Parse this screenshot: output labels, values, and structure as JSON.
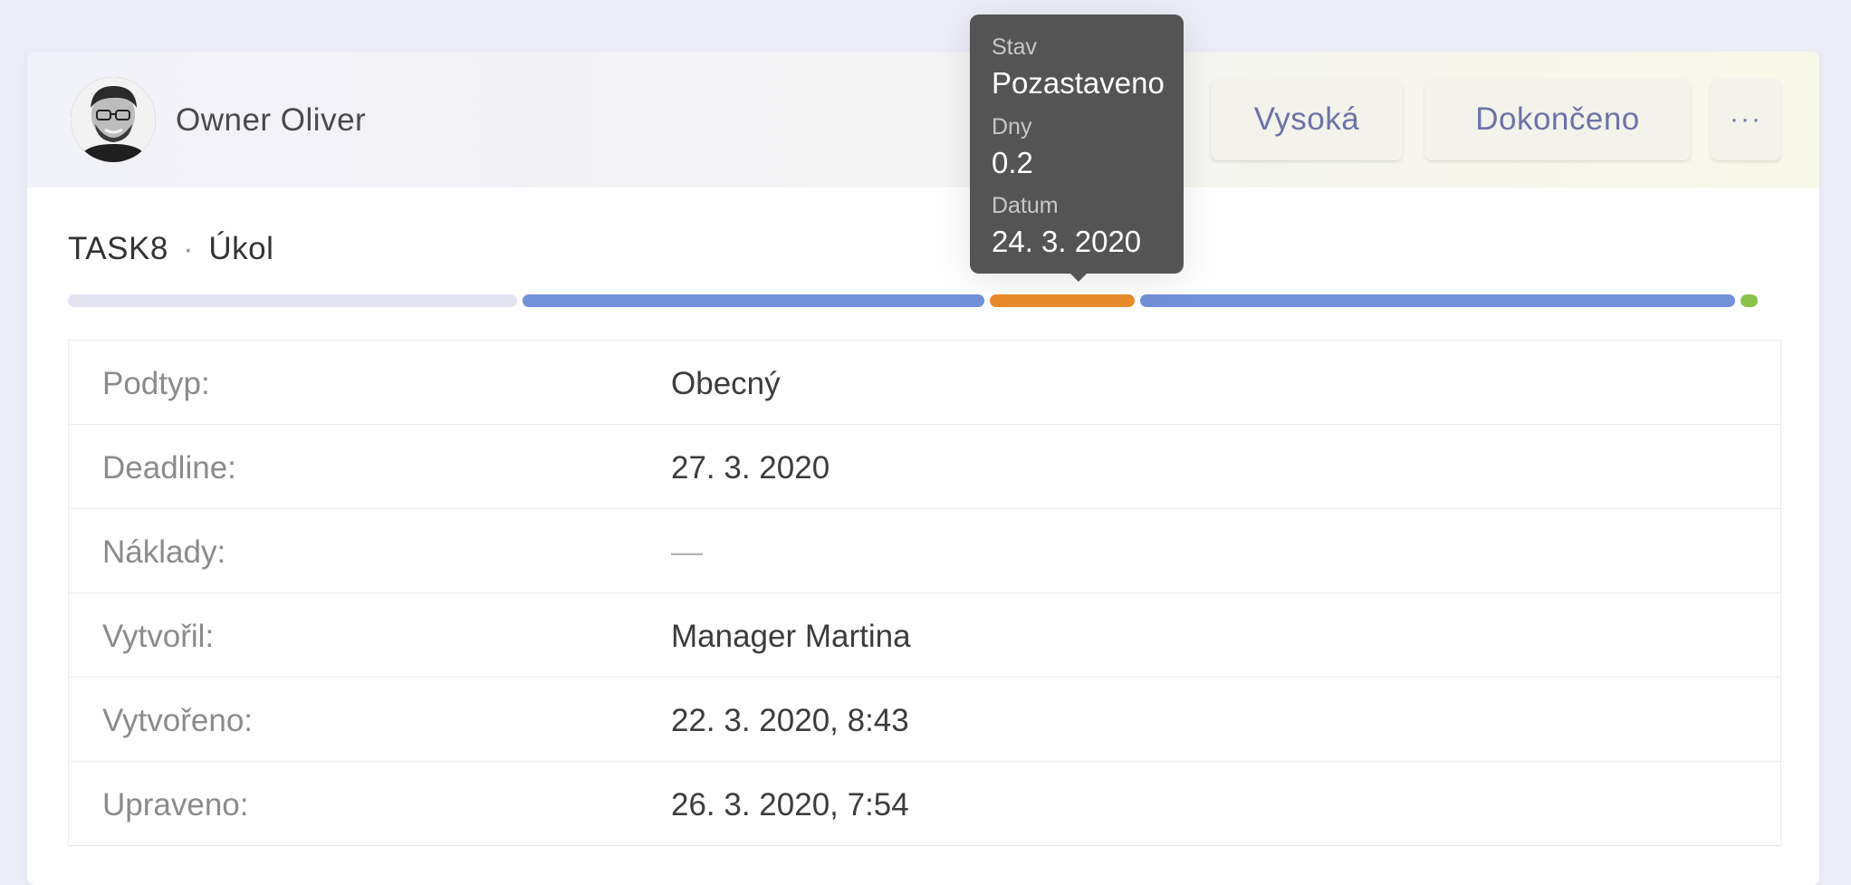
{
  "header": {
    "owner_name": "Owner Oliver",
    "priority_label": "Vysoká",
    "status_label": "Dokončeno",
    "more_label": "···"
  },
  "task": {
    "id": "TASK8",
    "separator": "·",
    "type": "Úkol"
  },
  "timeline": {
    "segments": [
      {
        "state": "pending",
        "color": "#e4e3f1",
        "fraction": 0.2597
      },
      {
        "state": "active",
        "color": "#7391d8",
        "fraction": 0.267
      },
      {
        "state": "paused",
        "color": "#e98b2a",
        "fraction": 0.0838
      },
      {
        "state": "active",
        "color": "#7391d8",
        "fraction": 0.3443
      },
      {
        "state": "done",
        "color": "#8bc34a",
        "fraction": 0.0101
      }
    ]
  },
  "tooltip": {
    "state_label": "Stav",
    "state_value": "Pozastaveno",
    "days_label": "Dny",
    "days_value": "0.2",
    "date_label": "Datum",
    "date_value": "24. 3. 2020"
  },
  "details": [
    {
      "label": "Podtyp:",
      "value": "Obecný",
      "empty": false
    },
    {
      "label": "Deadline:",
      "value": "27. 3. 2020",
      "empty": false
    },
    {
      "label": "Náklady:",
      "value": "—",
      "empty": true
    },
    {
      "label": "Vytvořil:",
      "value": "Manager Martina",
      "empty": false
    },
    {
      "label": "Vytvořeno:",
      "value": "22. 3. 2020, 8:43",
      "empty": false
    },
    {
      "label": "Upraveno:",
      "value": "26. 3. 2020, 7:54",
      "empty": false
    }
  ]
}
